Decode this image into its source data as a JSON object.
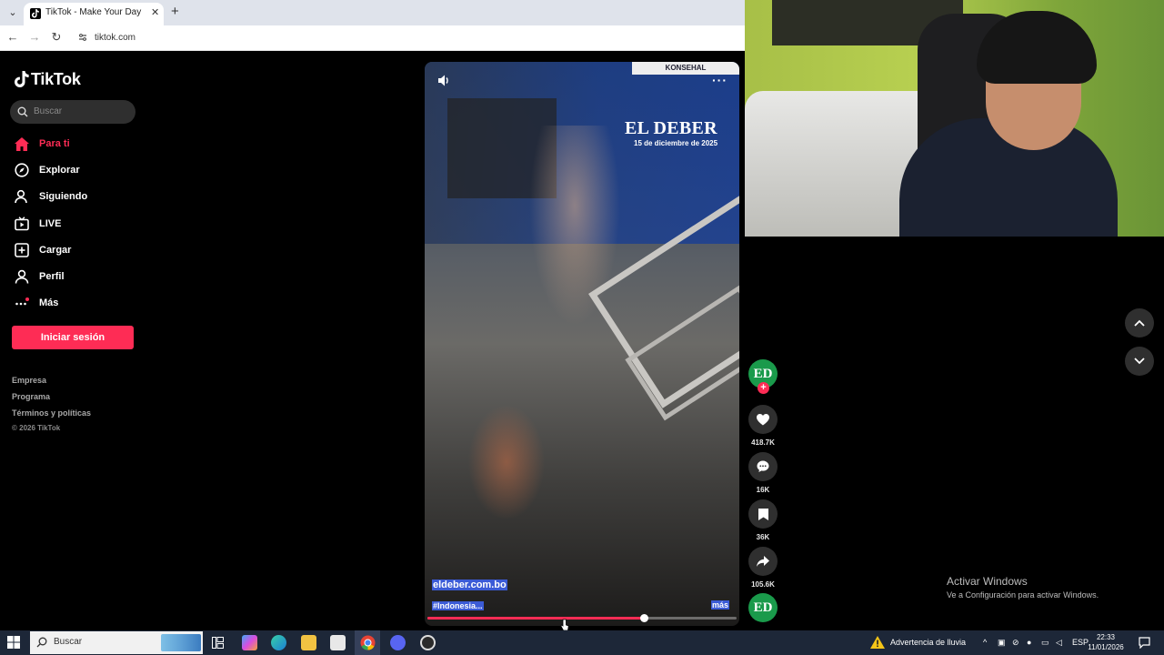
{
  "browser": {
    "tab_title": "TikTok - Make Your Day",
    "url": "tiktok.com"
  },
  "tiktok": {
    "logo_text": "TikTok",
    "search_placeholder": "Buscar",
    "nav": [
      {
        "label": "Para ti",
        "icon": "home-icon",
        "active": true
      },
      {
        "label": "Explorar",
        "icon": "compass-icon",
        "active": false
      },
      {
        "label": "Siguiendo",
        "icon": "user-icon",
        "active": false
      },
      {
        "label": "LIVE",
        "icon": "live-icon",
        "active": false
      },
      {
        "label": "Cargar",
        "icon": "upload-icon",
        "active": false
      },
      {
        "label": "Perfil",
        "icon": "profile-icon",
        "active": false
      },
      {
        "label": "Más",
        "icon": "more-dots-icon",
        "active": false
      }
    ],
    "login_label": "Iniciar sesión",
    "footer": {
      "links": [
        "Empresa",
        "Programa",
        "Términos y políticas"
      ],
      "copyright": "© 2026 TikTok"
    },
    "accent_color": "#fe2c55"
  },
  "video": {
    "watermark_title": "EL DEBER",
    "watermark_date": "15 de diciembre de 2025",
    "banner_text": "KONSEHAL",
    "caption_link": "eldeber.com.bo",
    "caption_tag": "#Indonesia...",
    "caption_more": "más",
    "progress_percent": 70
  },
  "actions": {
    "avatar_text": "ED",
    "likes": "418.7K",
    "comments": "16K",
    "saves": "36K",
    "shares": "105.6K"
  },
  "windows_notice": {
    "line1": "Activar Windows",
    "line2": "Ve a Configuración para activar Windows."
  },
  "taskbar": {
    "search_text": "Buscar",
    "weather_text": "Advertencia de lluvia",
    "language": "ESP",
    "time": "22:33",
    "date": "11/01/2026"
  }
}
